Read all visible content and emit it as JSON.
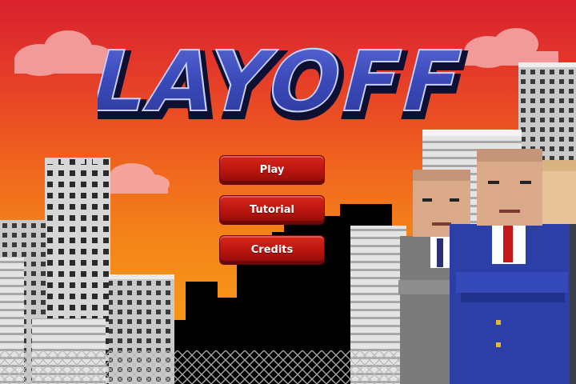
{
  "game": {
    "title": "LAYOFF"
  },
  "menu": {
    "items": [
      {
        "label": "Play"
      },
      {
        "label": "Tutorial"
      },
      {
        "label": "Credits"
      }
    ]
  },
  "colors": {
    "sky_top": "#d9212e",
    "sky_bottom": "#f59a1c",
    "title_blue": "#3a49b8",
    "button_red": "#c01a12",
    "skyline_black": "#000000"
  }
}
